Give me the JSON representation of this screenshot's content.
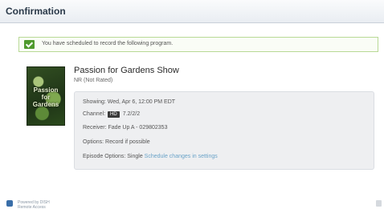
{
  "header": {
    "title": "Confirmation"
  },
  "notice": {
    "text": "You have scheduled to record the following program."
  },
  "program": {
    "poster_text": "Passion for Gardens",
    "title": "Passion for Gardens Show",
    "rating": "NR (Not Rated)"
  },
  "details": {
    "showing": "Showing: Wed, Apr 6, 12:00 PM EDT",
    "channel_label": "Channel:",
    "channel_badge": "HD",
    "channel_value": "7.2/2/2",
    "receiver": "Receiver: Fade Up A - 029802353",
    "options": "Options: Record if possible",
    "episode_label": "Episode Options: Single",
    "episode_link": "Schedule changes in settings"
  },
  "footer": {
    "line1": "Powered by DISH",
    "line2": "Remote Access"
  }
}
